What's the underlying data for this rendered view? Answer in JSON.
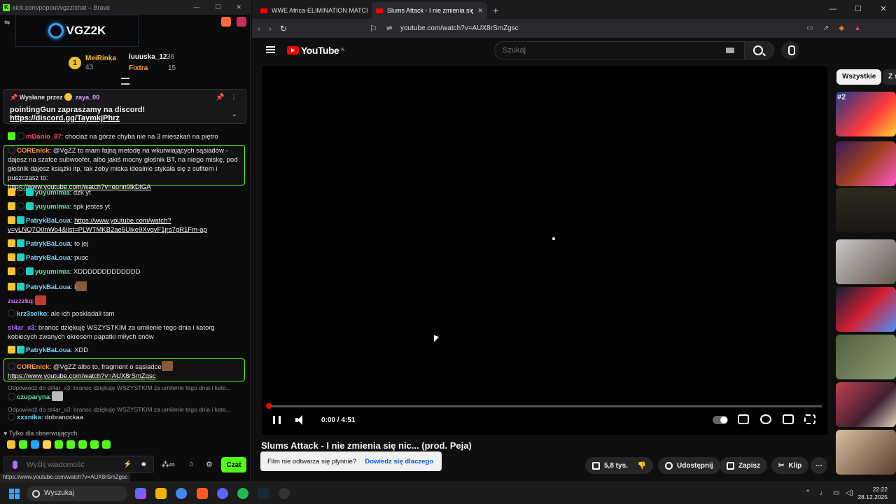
{
  "chat_window": {
    "title": "kick.com/popout/vgzz/chat – Brave",
    "logo_text": "VGZ2K",
    "leaderboard": {
      "rank1_medal": "1",
      "first": {
        "name": "MeiRinka",
        "count": "43"
      },
      "second": {
        "name": "luuuska_12",
        "count": "36"
      },
      "third": {
        "name": "Fixtra",
        "count": "15"
      }
    },
    "pinned": {
      "sent_by_label": "Wysłane przez",
      "sender": "zaya_00",
      "message_prefix": "pointingGun zapraszamy na discord! ",
      "link": "https://discord.gg/TaymkjPhrz"
    },
    "messages": [
      {
        "user": "mDanio_87",
        "color": "#ff4d6a",
        "text": ": chociaż na górze chyba nie na 3 mieszkań na piętro"
      },
      {
        "user": "COREnick",
        "color": "#ff9a3c",
        "text": ": @VgZZ to mam fajną metodę na wkurwiających sąsiadów - dajesz na szafce subwoofer, albo jakiś mocny głośnik BT, na niego miskę, pod głośnik dajesz książki itp, tak żeby miska idealnie stykała się z sufitem i puszczasz to:",
        "link": "https://www.youtube.com/watch?v=epnn9jkDlGA"
      },
      {
        "user": "yuyumimia",
        "color": "#5ee3a0",
        "text": ": dzk yt"
      },
      {
        "user": "yuyumimia",
        "color": "#5ee3a0",
        "text": ": spk jestes yt"
      },
      {
        "user": "PatrykBaLoua",
        "color": "#7dd3fc",
        "text": ": ",
        "link": "https://www.youtube.com/watch?v=yLNQ7O0nWo4&list=PLWTMKB2ae5Ulxe9XvqvF1jrs7gR1Fm-ap"
      },
      {
        "user": "PatrykBaLoua",
        "color": "#7dd3fc",
        "text": ": to jej"
      },
      {
        "user": "PatrykBaLoua",
        "color": "#7dd3fc",
        "text": ": pusc"
      },
      {
        "user": "yuyumimia",
        "color": "#5ee3a0",
        "text": ": XDDDDDDDDDDDDD"
      },
      {
        "user": "PatrykBaLoua",
        "color": "#7dd3fc",
        "text": ": l"
      },
      {
        "user": "zuzzzkq",
        "color": "#d96cff",
        "text": ":"
      },
      {
        "user": "krz3selko",
        "color": "#7dd3fc",
        "text": ": ale ich poskladali tam"
      },
      {
        "user": "st4ar_x3",
        "color": "#a970ff",
        "text": ": branoc dziękuję WSZYSTKIM za umilenie tego dnia i katorg kobiecych zwanych okresem papatki miłych snów"
      },
      {
        "user": "PatrykBaLoua",
        "color": "#7dd3fc",
        "text": ": XDD"
      },
      {
        "user": "COREnick",
        "color": "#ff9a3c",
        "text": ": @VgZZ albo to, fragment o sąsiadce",
        "link": "https://www.youtube.com/watch?v=AUX8rSmZgsc"
      },
      {
        "user": "czuparyna",
        "color": "#5ee3a0",
        "text": ":"
      },
      {
        "user": "xxxnika",
        "color": "#7dd3fc",
        "text": ": dobranockaa"
      }
    ],
    "reply_1": "Odpowiedź do st4ar_x3: branoc dziękuję WSZYSTKIM za umilenie tego dnia i kato...",
    "reply_2": "Odpowiedź do st4ar_x3: branoc dziękuję WSZYSTKIM za umilenie tego dnia i kato...",
    "followers_only": "Tylko dla obserwujących",
    "input_placeholder": "Wyślij wiadomość",
    "send_label": "Czat",
    "url_tooltip": "https://www.youtube.com/watch?v=AUX8rSmZgsc"
  },
  "browser": {
    "tabs": [
      {
        "title": "WWE Africa-ELIMINATION MATCH! "
      },
      {
        "title": "Slums Attack - I nie zmienia się nic"
      }
    ],
    "url": "youtube.com/watch?v=AUX8rSmZgsc",
    "youtube": {
      "logo": "YouTube",
      "region": "PL",
      "search_placeholder": "Szukaj",
      "time": "0:00 / 4:51",
      "progress_fraction": 0.0,
      "video_title": "Slums Attack - I nie zmienia się nic... (prod. Peja)",
      "toast_text": "Film nie odtwarza się płynnie?",
      "toast_link": "Dowiedz się dlaczego",
      "like_count": "5,8 tys.",
      "share_label": "Udostępnij",
      "save_label": "Zapisz",
      "clip_label": "Klip",
      "chips": [
        "Wszystkie",
        "Z se"
      ],
      "thumb_overlay_1": "#2"
    }
  },
  "taskbar": {
    "search_label": "Wyszukaj",
    "time": "22:22",
    "date": "28.12.2025"
  }
}
